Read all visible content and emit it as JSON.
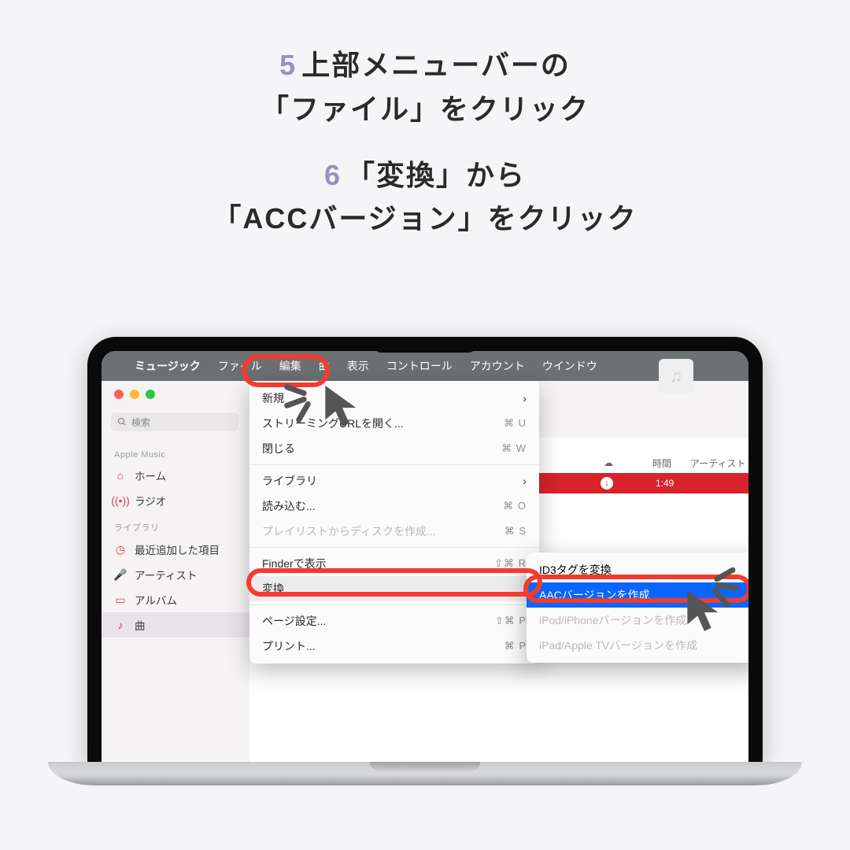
{
  "instructions": {
    "step5_num": "5",
    "step5_l1": "上部メニューバーの",
    "step5_l2": "「ファイル」をクリック",
    "step6_num": "6",
    "step6_l1": "「変換」から",
    "step6_l2": "「ACCバージョン」をクリック"
  },
  "menubar": {
    "app": "ミュージック",
    "items": [
      "ファイル",
      "編集",
      "曲",
      "表示",
      "コントロール",
      "アカウント",
      "ウインドウ"
    ]
  },
  "search": {
    "placeholder": "検索"
  },
  "sidebar": {
    "section1": "Apple Music",
    "home": "ホーム",
    "radio": "ラジオ",
    "section2": "ライブラリ",
    "recent": "最近追加した項目",
    "artist": "アーティスト",
    "album": "アルバム",
    "song": "曲"
  },
  "columns": {
    "time": "時間",
    "artist": "アーティスト"
  },
  "track": {
    "time": "1:49"
  },
  "menu": {
    "new": "新規",
    "open_stream": "ストリーミングURLを開く...",
    "open_stream_sc": "⌘ U",
    "close": "閉じる",
    "close_sc": "⌘ W",
    "library": "ライブラリ",
    "import": "読み込む...",
    "import_sc": "⌘ O",
    "burn": "プレイリストからディスクを作成...",
    "burn_sc": "⌘ S",
    "reveal": "Finderで表示",
    "reveal_sc": "⇧⌘ R",
    "convert": "変換",
    "page_setup": "ページ設定...",
    "page_setup_sc": "⇧⌘ P",
    "print": "プリント...",
    "print_sc": "⌘ P"
  },
  "submenu": {
    "id3": "ID3タグを変換",
    "aac": "AACバージョンを作成",
    "ipod": "iPod/iPhoneバージョンを作成",
    "ipad": "iPad/Apple TVバージョンを作成"
  }
}
